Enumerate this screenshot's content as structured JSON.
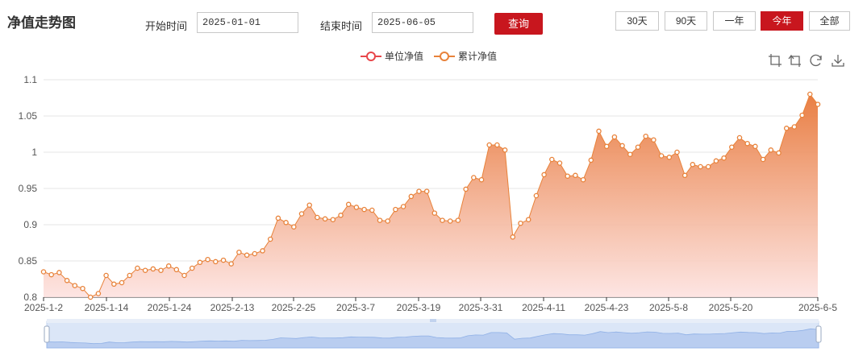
{
  "header": {
    "title": "净值走势图",
    "start_label": "开始时间",
    "start_value": "2025-01-01",
    "end_label": "结束时间",
    "end_value": "2025-06-05",
    "query_label": "查询"
  },
  "ranges": [
    {
      "label": "30天",
      "active": false
    },
    {
      "label": "90天",
      "active": false
    },
    {
      "label": "一年",
      "active": false
    },
    {
      "label": "今年",
      "active": true
    },
    {
      "label": "全部",
      "active": false
    }
  ],
  "toolbar_icons": [
    "zoom-icon",
    "zoom-reset-icon",
    "restore-icon",
    "download-icon"
  ],
  "colors": {
    "accent": "#c8161e",
    "series1": "#e8464a",
    "series2": "#e8823a"
  },
  "chart_data": {
    "type": "area",
    "series": [
      {
        "name": "单位净值",
        "values": []
      },
      {
        "name": "累计净值",
        "values": [
          0.835,
          0.831,
          0.834,
          0.823,
          0.816,
          0.812,
          0.8,
          0.805,
          0.83,
          0.818,
          0.82,
          0.83,
          0.84,
          0.837,
          0.839,
          0.837,
          0.843,
          0.838,
          0.83,
          0.84,
          0.848,
          0.852,
          0.849,
          0.851,
          0.846,
          0.862,
          0.858,
          0.86,
          0.864,
          0.88,
          0.909,
          0.903,
          0.897,
          0.915,
          0.927,
          0.91,
          0.908,
          0.907,
          0.913,
          0.928,
          0.924,
          0.921,
          0.92,
          0.906,
          0.905,
          0.921,
          0.925,
          0.939,
          0.946,
          0.946,
          0.916,
          0.906,
          0.905,
          0.906,
          0.949,
          0.965,
          0.962,
          1.01,
          1.01,
          1.003,
          0.883,
          0.902,
          0.907,
          0.94,
          0.969,
          0.99,
          0.985,
          0.967,
          0.968,
          0.962,
          0.989,
          1.029,
          1.008,
          1.021,
          1.009,
          0.997,
          1.007,
          1.022,
          1.017,
          0.995,
          0.993,
          1.0,
          0.968,
          0.983,
          0.98,
          0.98,
          0.988,
          0.992,
          1.007,
          1.02,
          1.012,
          1.008,
          0.99,
          1.003,
          0.999,
          1.033,
          1.035,
          1.051,
          1.08,
          1.066
        ]
      }
    ],
    "x_ticks": [
      "2025-1-2",
      "2025-1-14",
      "2025-1-24",
      "2025-2-13",
      "2025-2-25",
      "2025-3-7",
      "2025-3-19",
      "2025-3-31",
      "2025-4-11",
      "2025-4-23",
      "2025-5-8",
      "2025-5-20",
      "2025-6-5"
    ],
    "y_ticks": [
      "1.1",
      "1.05",
      "1",
      "0.95",
      "0.9",
      "0.85",
      "0.8"
    ],
    "ylim": [
      0.8,
      1.1
    ],
    "grid": true,
    "legend_position": "top"
  }
}
